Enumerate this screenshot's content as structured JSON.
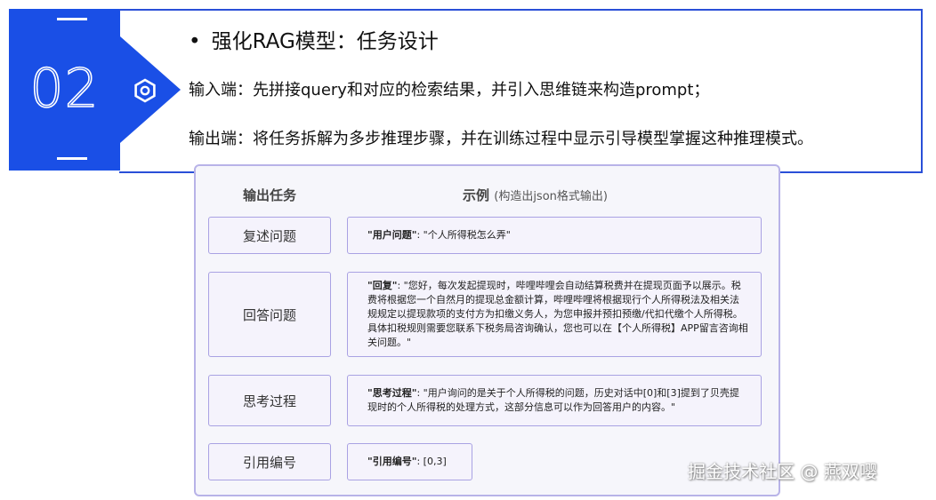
{
  "slide": {
    "number": "02",
    "heading": "强化RAG模型：任务设计",
    "bullet": "•",
    "input_line": "输入端：先拼接query和对应的检索结果，并引入思维链来构造prompt；",
    "output_line": "输出端：将任务拆解为多步推理步骤，并在训练过程中显示引导模型掌握这种推理模式。"
  },
  "table": {
    "col_task": "输出任务",
    "col_example": "示例",
    "col_example_note": "(构造出json格式输出)",
    "rows": [
      {
        "task": "复述问题",
        "key": "\"用户问题\"",
        "value": ": \"个人所得税怎么弄\""
      },
      {
        "task": "回答问题",
        "key": "\"回复\"",
        "value": ": \"您好，每次发起提现时，哔哩哔哩会自动结算税费并在提现页面予以展示。税费将根据您一个自然月的提现总金额计算，哔哩哔哩将根据现行个人所得税法及相关法规规定以提现款项的支付方为扣缴义务人，为您申报并预扣预缴/代扣代缴个人所得税。具体扣税规则需要您联系下税务局咨询确认，您也可以在【个人所得税】APP留言咨询相关问题。\""
      },
      {
        "task": "思考过程",
        "key": "\"思考过程\"",
        "value": ": \"用户询问的是关于个人所得税的问题，历史对话中[0]和[3]提到了贝壳提现时的个人所得税的处理方式，这部分信息可以作为回答用户的内容。\""
      },
      {
        "task": "引用编号",
        "key": "\"引用编号\"",
        "value": ": [0,3]"
      }
    ]
  },
  "watermark": "掘金技术社区 @ 燕双嘤",
  "colors": {
    "accent": "#1a4fe6",
    "panel_border": "#b8b3e8",
    "cell_border": "#a9a2e3"
  }
}
